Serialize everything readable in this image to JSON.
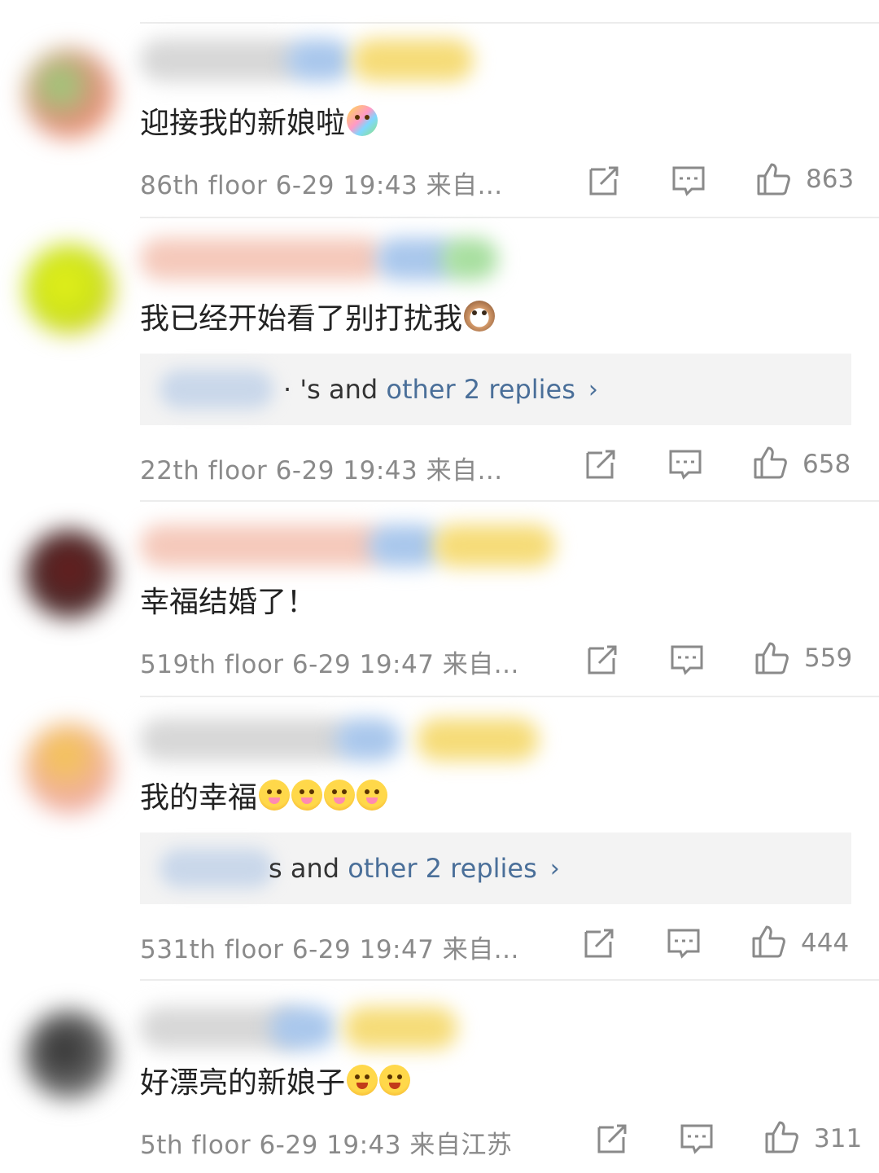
{
  "comments": [
    {
      "text": "迎接我的新娘啦",
      "floor": "86th floor",
      "date": "6-29 19:43",
      "from": "来自...",
      "likes": "863"
    },
    {
      "text": "我已经开始看了别打扰我",
      "reply_prefix": "· 's and",
      "reply_link": "other 2 replies",
      "floor": "22th floor",
      "date": "6-29 19:43",
      "from": "来自...",
      "likes": "658"
    },
    {
      "text": "幸福结婚了！",
      "floor": "519th floor",
      "date": "6-29 19:47",
      "from": "来自...",
      "likes": "559"
    },
    {
      "text": "我的幸福",
      "reply_prefix": "s and",
      "reply_link": "other 2 replies",
      "floor": "531th floor",
      "date": "6-29 19:47",
      "from": "来自...",
      "likes": "444"
    },
    {
      "text": "好漂亮的新娘子",
      "floor": "5th floor",
      "date": "6-29 19:43",
      "from": "来自江苏",
      "likes": "311"
    }
  ],
  "icons": {
    "share": "share-icon",
    "comment": "comment-icon",
    "like": "thumbs-up-icon",
    "chevron": "chevron-right-icon"
  },
  "colors": {
    "link": "#4a6f99",
    "meta": "#8a8a8a",
    "text": "#222222",
    "reply_bg": "#f3f3f3"
  }
}
